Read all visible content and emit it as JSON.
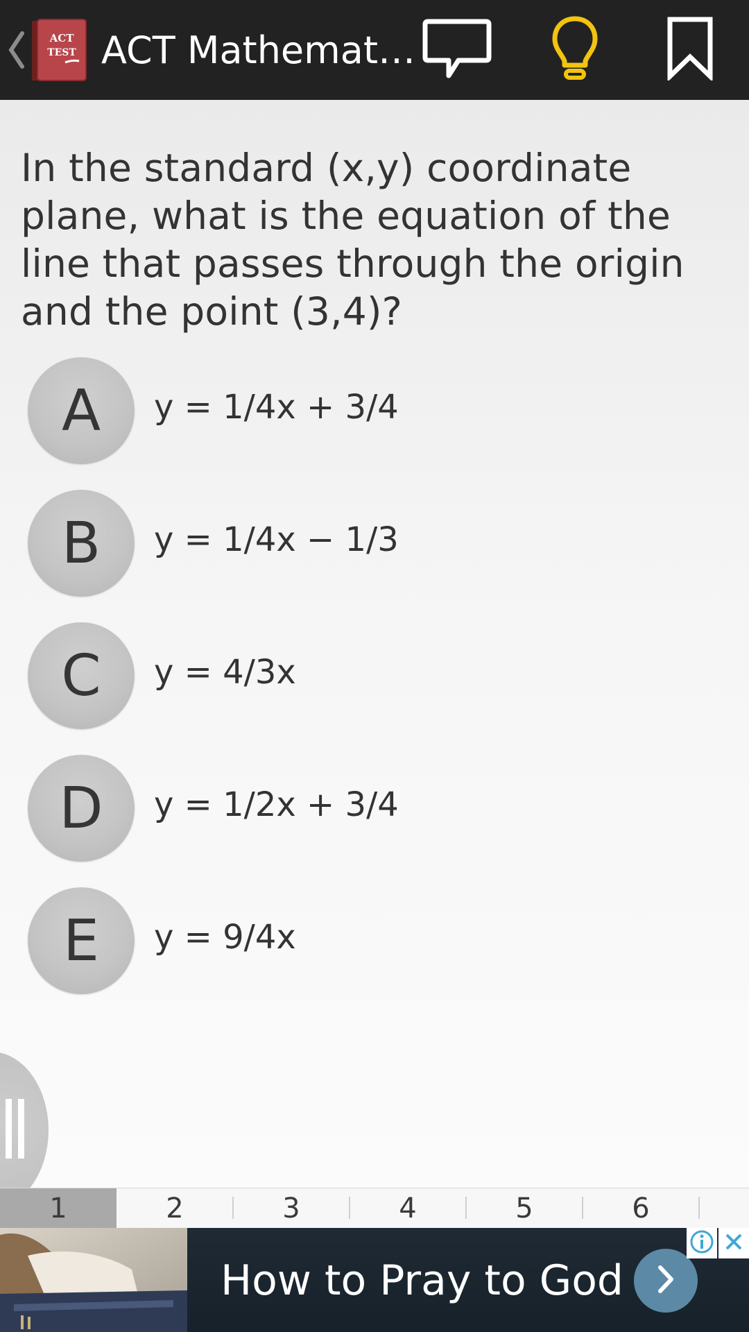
{
  "action_bar": {
    "title": "ACT Mathemat…",
    "app_icon_text": [
      "ACT",
      "TEST"
    ],
    "icons": {
      "back": "chevron-left-icon",
      "comment": "comment-bubble-icon",
      "hint": "lightbulb-icon",
      "bookmark": "bookmark-icon"
    },
    "hint_color": "#f2c40f"
  },
  "question": {
    "text": "In the standard (x,y) coordinate plane, what is the equation of the line that passes through the origin and the point (3,4)?"
  },
  "options": [
    {
      "letter": "A",
      "text": "y = 1/4x + 3/4"
    },
    {
      "letter": "B",
      "text": "y = 1/4x − 1/3"
    },
    {
      "letter": "C",
      "text": "y = 4/3x"
    },
    {
      "letter": "D",
      "text": "y = 1/2x + 3/4"
    },
    {
      "letter": "E",
      "text": "y = 9/4x"
    }
  ],
  "drawer": {
    "icon": "drawer-handle-icon"
  },
  "pager": {
    "pages": [
      "1",
      "2",
      "3",
      "4",
      "5",
      "6"
    ],
    "active": "1"
  },
  "ad": {
    "headline": "How to Pray to God",
    "icons": {
      "info": "info-icon",
      "close": "close-icon",
      "arrow": "chevron-right-icon"
    }
  }
}
